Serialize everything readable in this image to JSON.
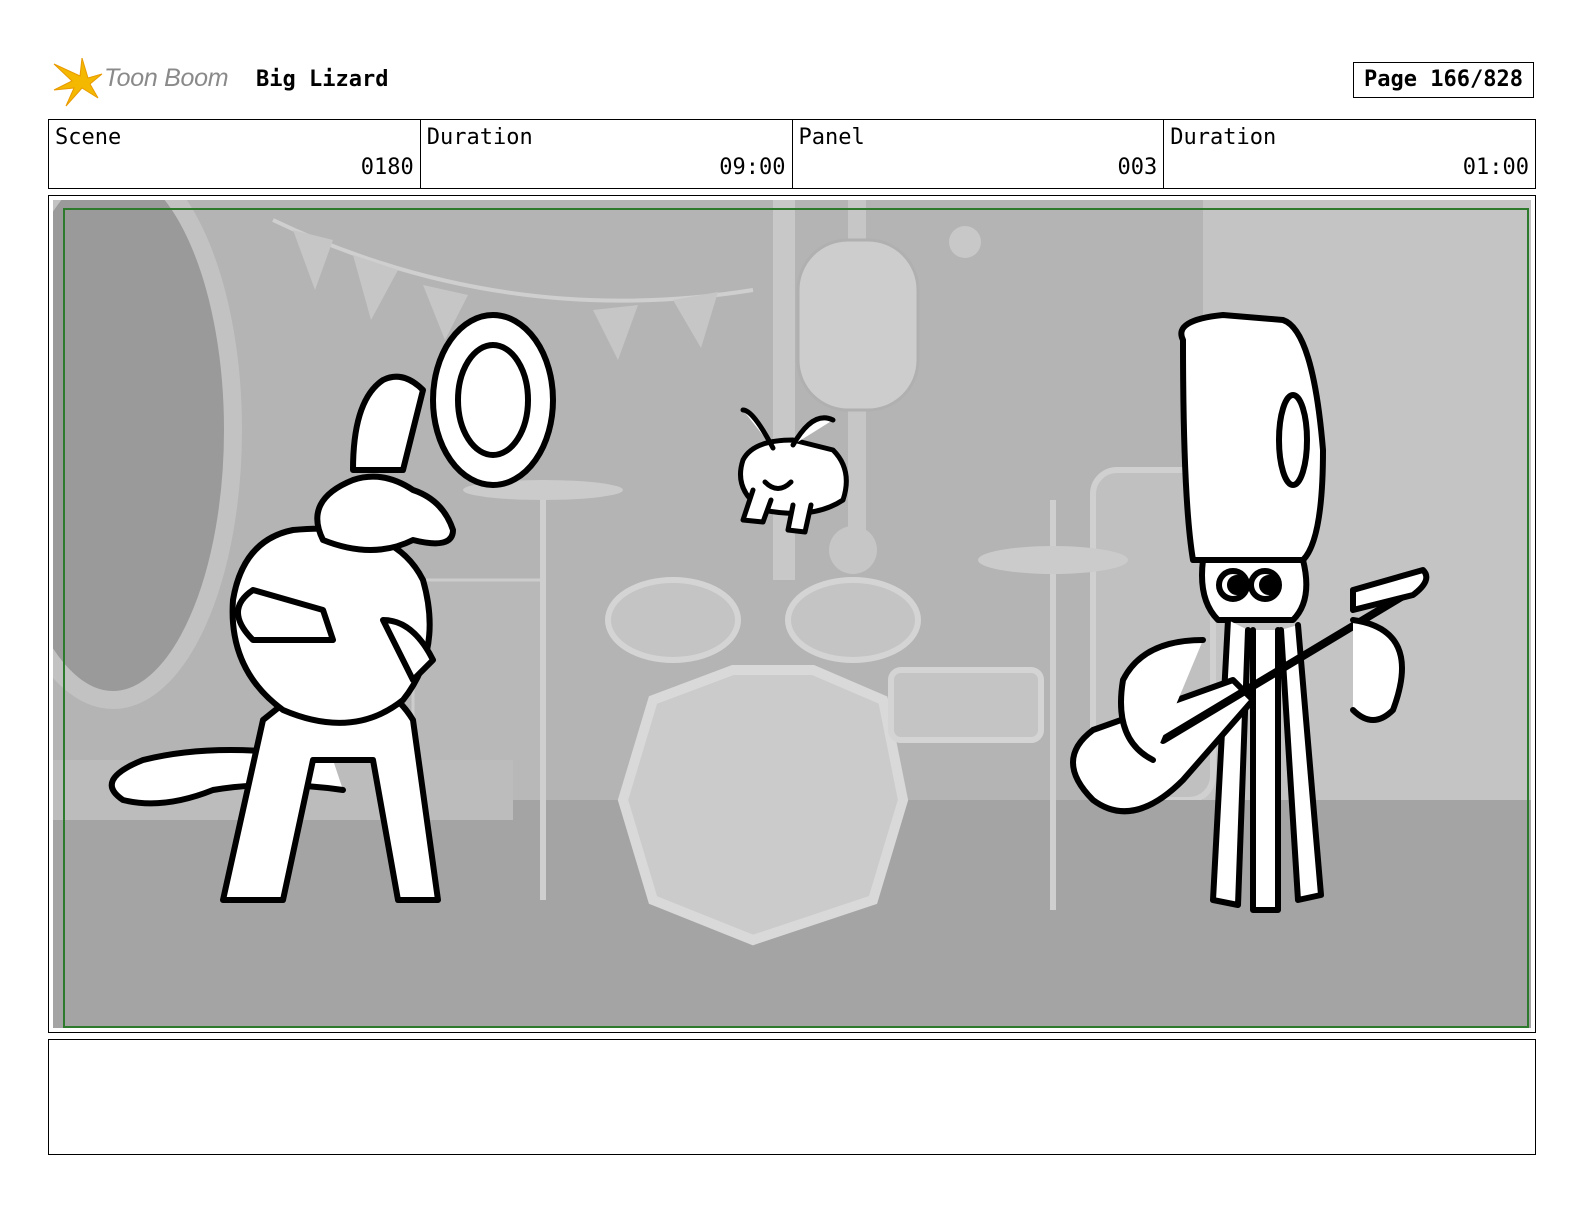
{
  "header": {
    "logo_text": "Toon Boom",
    "project_title": "Big Lizard",
    "page_indicator": "Page 166/828"
  },
  "info": [
    {
      "label": "Scene",
      "value": "0180"
    },
    {
      "label": "Duration",
      "value": "09:00"
    },
    {
      "label": "Panel",
      "value": "003"
    },
    {
      "label": "Duration",
      "value": "01:00"
    }
  ],
  "panel": {
    "safe_frame_color": "#2d7a2d",
    "background_color": "#a8a8a8",
    "characters": [
      "lizard-tuba-player",
      "flying-bug",
      "squid-guitarist"
    ]
  },
  "notes": {
    "text": ""
  }
}
